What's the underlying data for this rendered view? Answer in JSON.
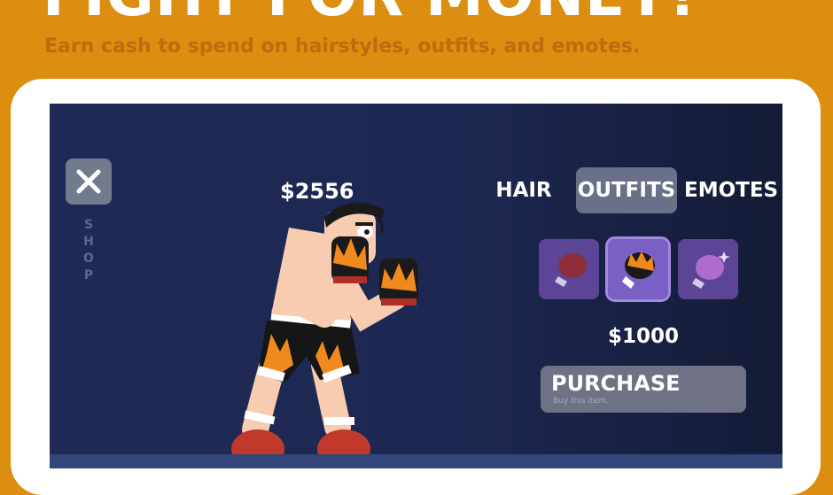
{
  "promo": {
    "title": "FIGHT FOR MONEY!",
    "subtitle": "Earn cash to spend on hairstyles, outfits, and emotes."
  },
  "game": {
    "close_icon": "close-icon",
    "shop_label": "SHOP",
    "money": "$2556",
    "tabs": [
      {
        "label": "HAIR",
        "active": false
      },
      {
        "label": "OUTFITS",
        "active": true
      },
      {
        "label": "EMOTES",
        "active": false
      }
    ],
    "items": [
      {
        "icon": "red-glove-icon",
        "selected": false
      },
      {
        "icon": "flame-glove-icon",
        "selected": true
      },
      {
        "icon": "pink-glove-sparkle-icon",
        "selected": false
      }
    ],
    "price": "$1000",
    "purchase_label": "PURCHASE",
    "purchase_hint": "Buy this item."
  },
  "colors": {
    "background": "#dc8e10",
    "screen": "#1e2a55",
    "slot": "#5c4596",
    "button": "#6f7284"
  }
}
